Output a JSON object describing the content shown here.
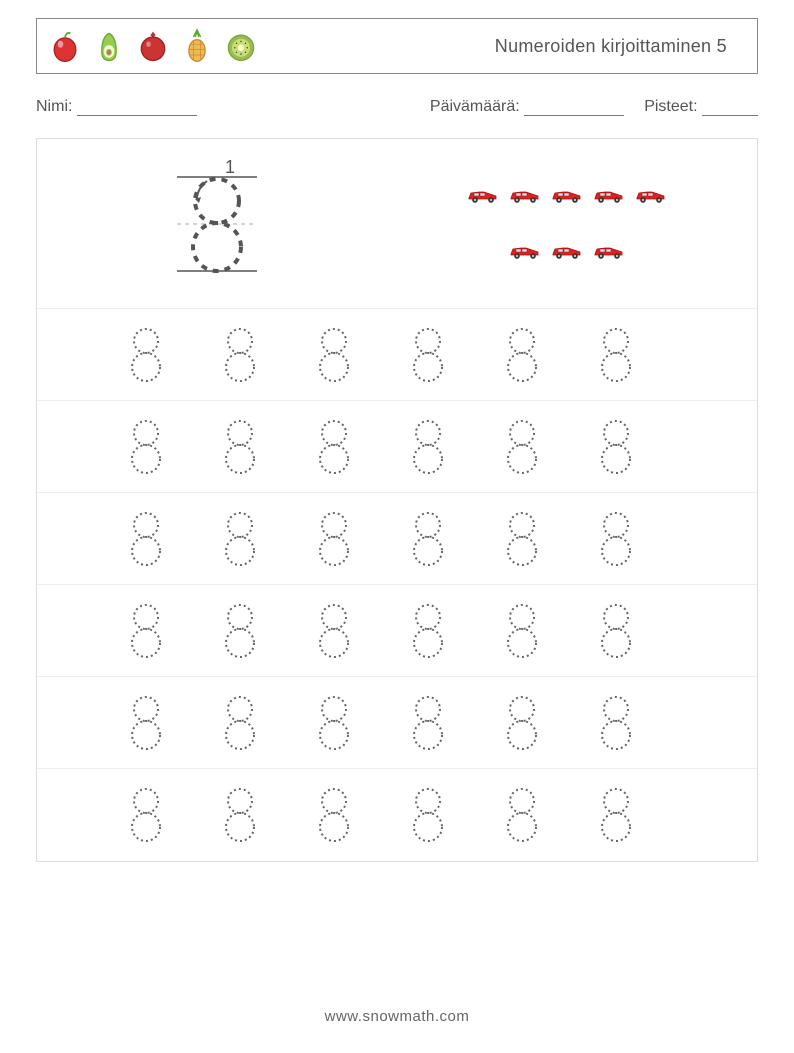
{
  "header": {
    "title": "Numeroiden kirjoittaminen 5",
    "fruits": [
      "apple",
      "avocado",
      "pomegranate",
      "pineapple",
      "kiwi"
    ]
  },
  "info": {
    "name_label": "Nimi:",
    "date_label": "Päivämäärä:",
    "score_label": "Pisteet:"
  },
  "demo": {
    "number": "8",
    "stroke_label": "1",
    "car_row1_count": 5,
    "car_row2_count": 3
  },
  "tracing": {
    "rows": 6,
    "cols": 6,
    "glyph": "8"
  },
  "footer": {
    "url": "www.snowmath.com"
  }
}
